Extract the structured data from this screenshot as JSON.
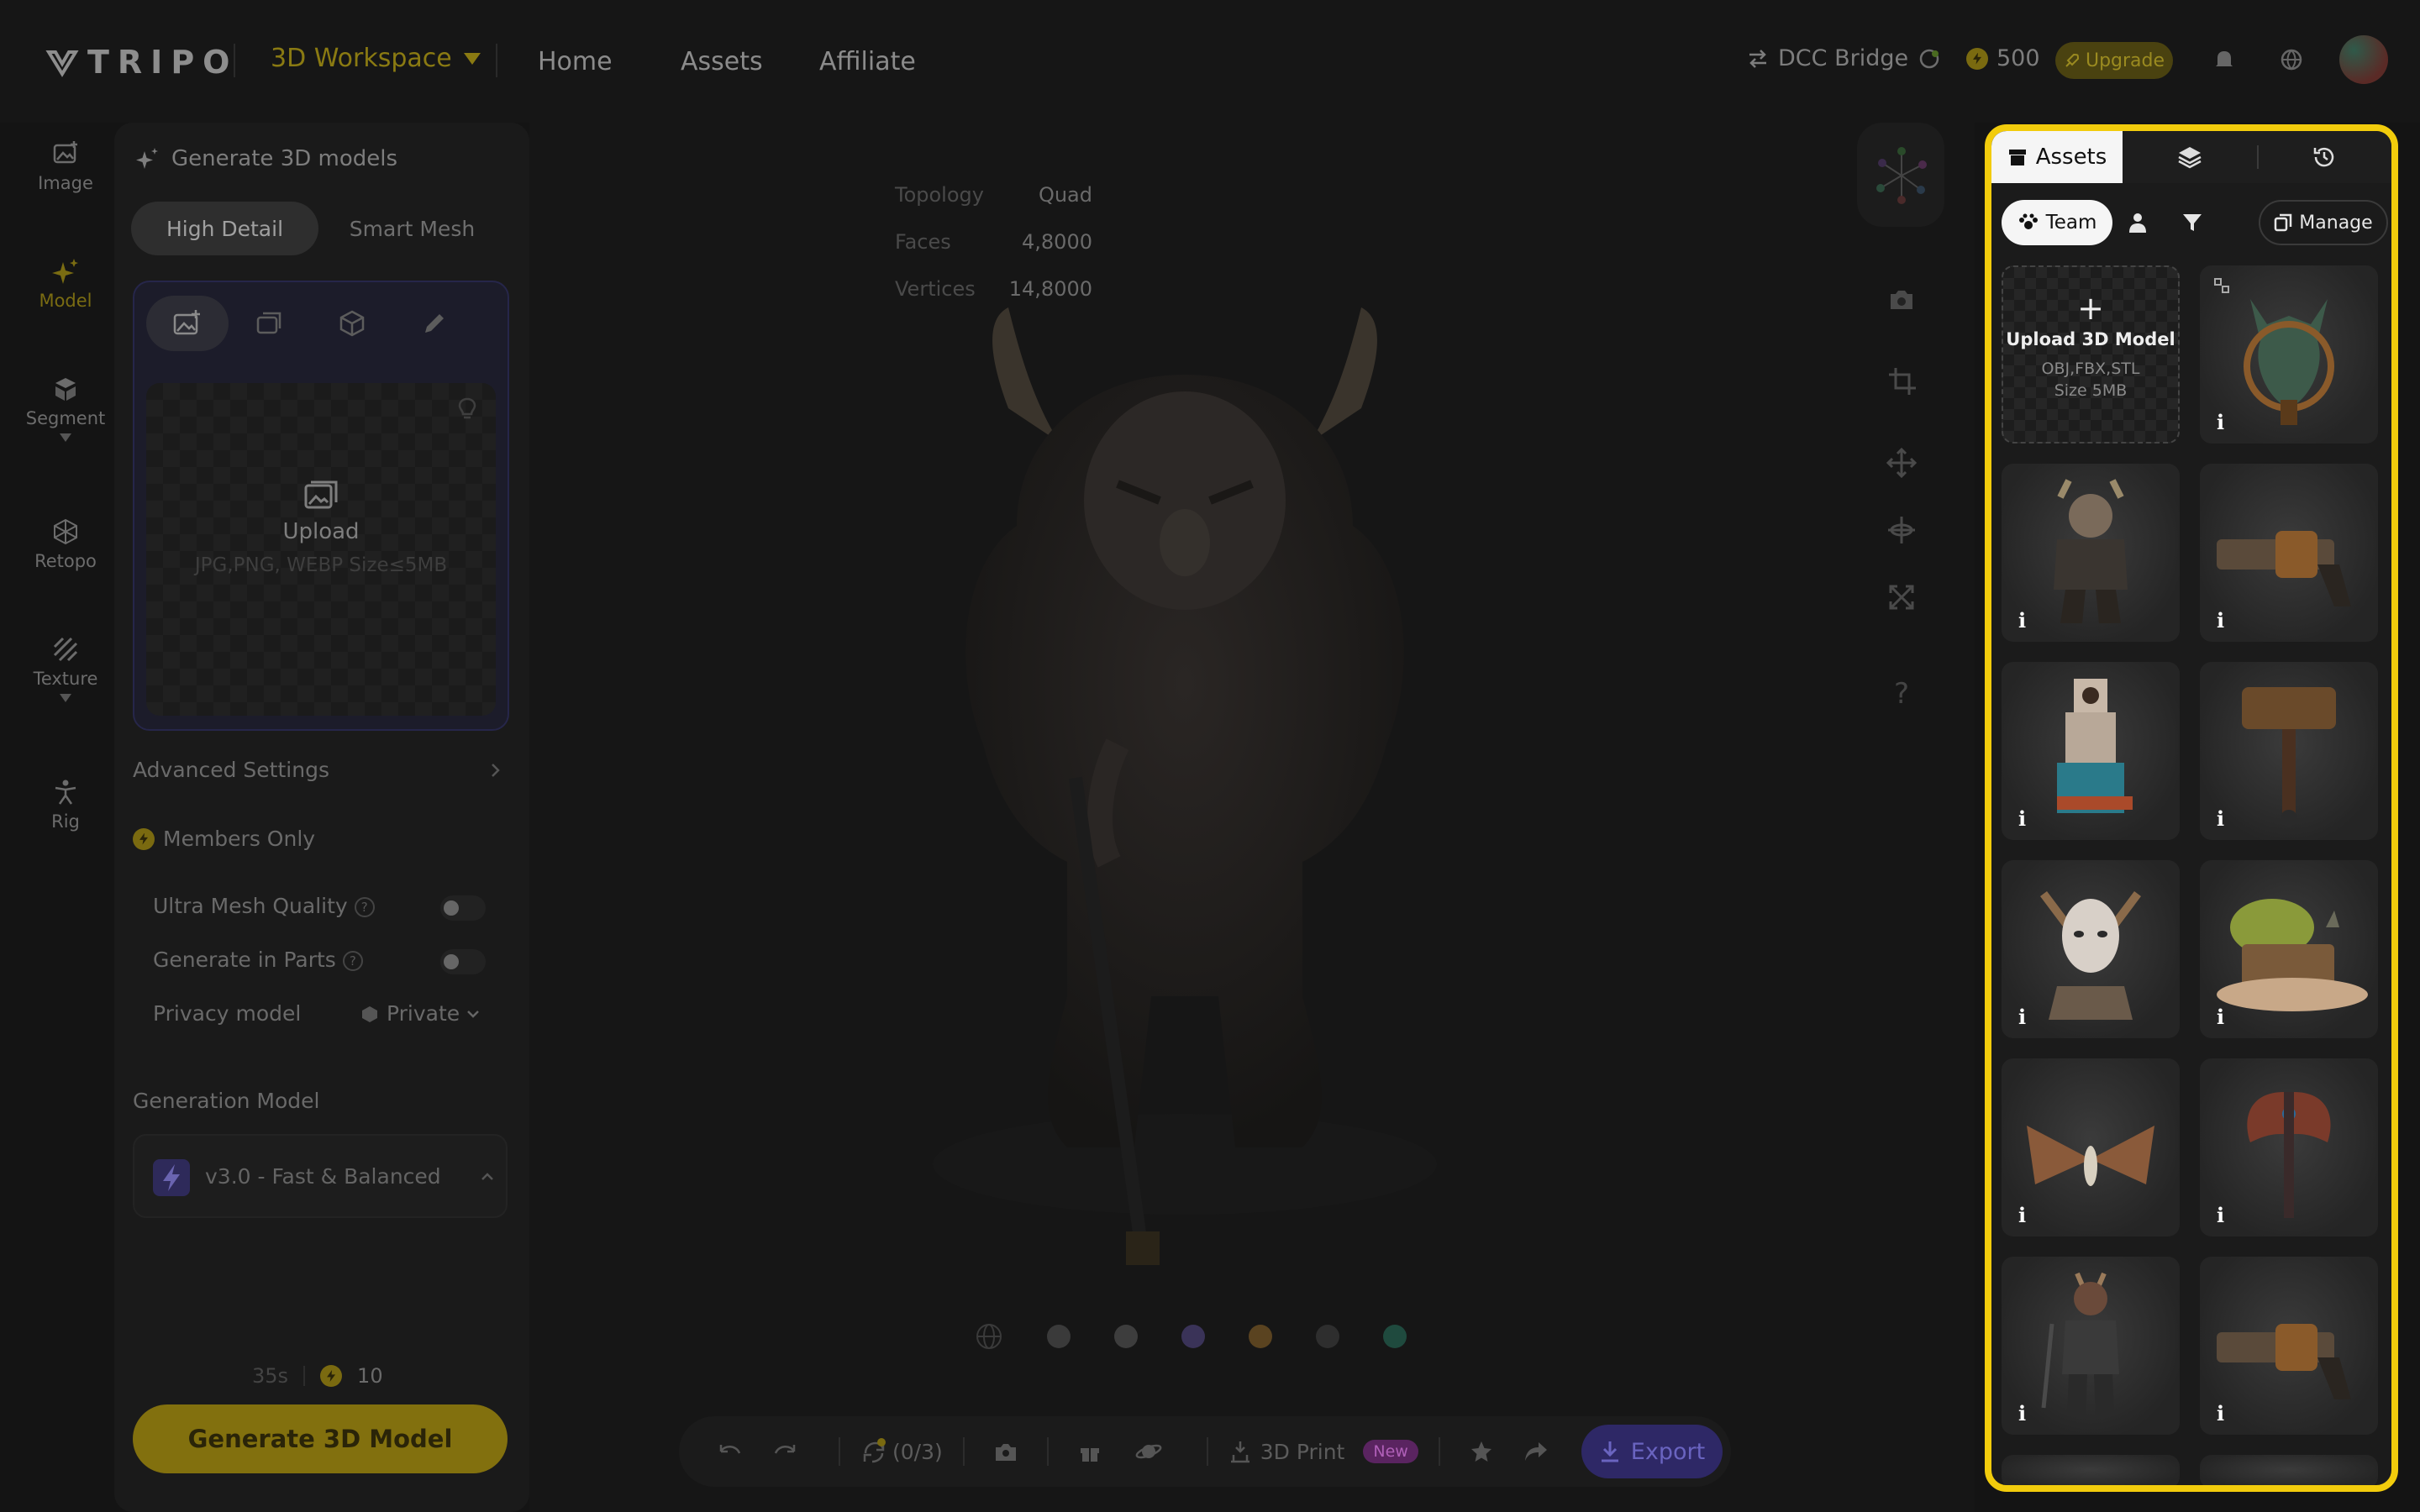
{
  "header": {
    "logo_text": "TRIPO",
    "workspace": "3D Workspace",
    "nav": [
      "Home",
      "Assets",
      "Affiliate"
    ],
    "dcc_bridge": "DCC Bridge",
    "credits": "500",
    "upgrade": "Upgrade"
  },
  "rail": {
    "items": [
      {
        "label": "Image",
        "icon": "image-plus-icon"
      },
      {
        "label": "Model",
        "icon": "sparkle-icon"
      },
      {
        "label": "Segment",
        "icon": "cube-segment-icon"
      },
      {
        "label": "Retopo",
        "icon": "mesh-icon"
      },
      {
        "label": "Texture",
        "icon": "texture-icon"
      },
      {
        "label": "Rig",
        "icon": "figure-icon"
      }
    ]
  },
  "panel": {
    "title": "Generate 3D models",
    "modes": [
      "High Detail",
      "Smart Mesh"
    ],
    "upload_label": "Upload",
    "upload_formats": "JPG,PNG, WEBP  Size≤5MB",
    "advanced": "Advanced Settings",
    "members_only": "Members Only",
    "ultra_mesh": "Ultra Mesh Quality",
    "gen_parts": "Generate in Parts",
    "privacy_label": "Privacy model",
    "privacy_value": "Private",
    "gen_model_label": "Generation Model",
    "gen_model_value": "v3.0 - Fast & Balanced",
    "time": "35s",
    "cost": "10",
    "generate": "Generate 3D Model"
  },
  "viewport": {
    "topology_label": "Topology",
    "topology_value": "Quad",
    "faces_label": "Faces",
    "faces_value": "4,8000",
    "vertices_label": "Vertices",
    "vertices_value": "14,8000",
    "help": "?",
    "swatches": [
      "#3a3a3a",
      "#3d3d3d",
      "#3a3358",
      "#5a4320",
      "#2e2e2e",
      "#1f4a3e"
    ],
    "bottom": {
      "retry": "(0/3)",
      "print": "3D Print",
      "new_badge": "New",
      "export": "Export"
    }
  },
  "assets_panel": {
    "tab": "Assets",
    "team": "Team",
    "manage": "Manage",
    "upload_title": "Upload 3D Model",
    "upload_formats": "OBJ,FBX,STL",
    "upload_size": "Size 5MB",
    "info": "i",
    "items": [
      {
        "name": "dragon-bust"
      },
      {
        "name": "old-goblin"
      },
      {
        "name": "steampunk-gun"
      },
      {
        "name": "clock-tower-house"
      },
      {
        "name": "war-hammer"
      },
      {
        "name": "elf-bust"
      },
      {
        "name": "mushroom-house"
      },
      {
        "name": "moth"
      },
      {
        "name": "battle-axe"
      },
      {
        "name": "armored-warrior"
      },
      {
        "name": "steampunk-gun-2"
      }
    ]
  },
  "colors": {
    "accent_yellow": "#f2cc0c",
    "generate_btn": "#82700e",
    "export_btn": "#2e2866"
  }
}
